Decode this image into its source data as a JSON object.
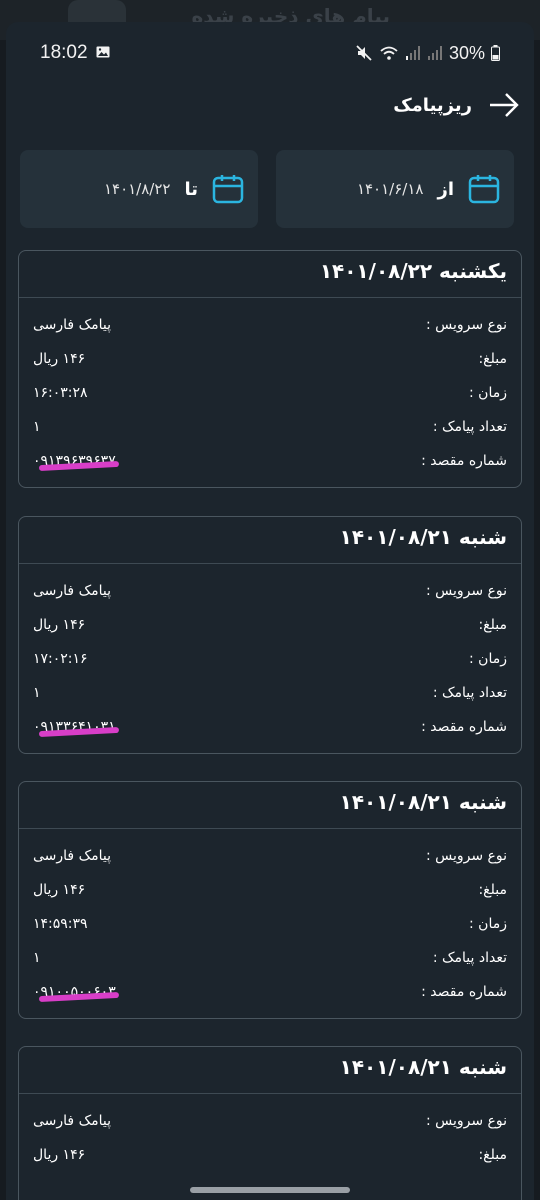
{
  "background_app": {
    "title": "پیام های ذخیره شده"
  },
  "status_bar": {
    "time": "18:02",
    "battery": "30%"
  },
  "header": {
    "title": "ریزپیامک"
  },
  "filters": {
    "from": {
      "prefix": "از",
      "value": "۱۴۰۱/۶/۱۸"
    },
    "to": {
      "prefix": "تا",
      "value": "۱۴۰۱/۸/۲۲"
    }
  },
  "labels": {
    "service_type": "نوع سرویس :",
    "amount": "مبلغ:",
    "time": "زمان :",
    "sms_count": "تعداد پیامک :",
    "destination": "شماره مقصد :"
  },
  "records": [
    {
      "date": "یکشنبه ۱۴۰۱/۰۸/۲۲",
      "service_type": "پیامک فارسی",
      "amount": "۱۴۶ ریال",
      "time": "۱۶:۰۳:۲۸",
      "sms_count": "۱",
      "destination": "۰۹۱۳۹۶۳۹۶۳۷"
    },
    {
      "date": "شنبه ۱۴۰۱/۰۸/۲۱",
      "service_type": "پیامک فارسی",
      "amount": "۱۴۶ ریال",
      "time": "۱۷:۰۲:۱۶",
      "sms_count": "۱",
      "destination": "۰۹۱۳۳۶۴۱۰۳۱"
    },
    {
      "date": "شنبه ۱۴۰۱/۰۸/۲۱",
      "service_type": "پیامک فارسی",
      "amount": "۱۴۶ ریال",
      "time": "۱۴:۵۹:۳۹",
      "sms_count": "۱",
      "destination": "۰۹۱۰۰۵۰۰۶۰۳"
    },
    {
      "date": "شنبه ۱۴۰۱/۰۸/۲۱",
      "service_type": "پیامک فارسی",
      "amount": "۱۴۶ ریال"
    }
  ],
  "colors": {
    "accent": "#2bb5e0",
    "redaction": "#d83ec8",
    "card_border": "#4a565f"
  },
  "icons": [
    "image-icon",
    "mute-icon",
    "wifi-icon",
    "signal-icon",
    "battery-icon",
    "arrow-right-icon",
    "calendar-icon"
  ]
}
